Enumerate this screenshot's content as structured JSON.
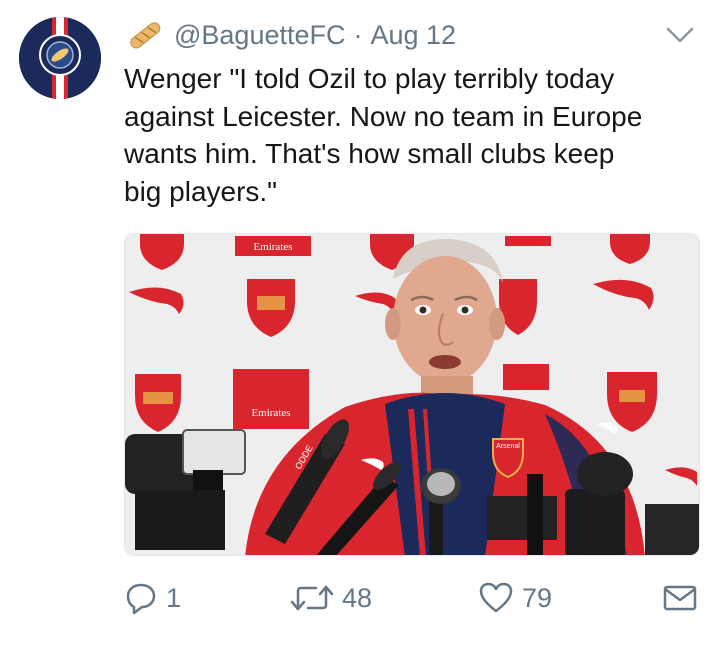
{
  "tweet": {
    "handle": "@BaguetteFC",
    "separator": "·",
    "date": "Aug 12",
    "text_lines": [
      "Wenger \"I told Ozil to play terribly today",
      "against Leicester. Now no team in Europe",
      "wants him. That's how small clubs keep",
      "big players.\""
    ],
    "media": {
      "board_text": [
        "Emirates",
        "Emirates",
        "Emirates"
      ],
      "shirt_text": "Arsenal",
      "mic_text": "ODDE"
    }
  },
  "actions": {
    "reply_count": "1",
    "retweet_count": "48",
    "like_count": "79"
  },
  "icons": {
    "header_emoji": "baguette-icon",
    "menu": "chevron-down-icon",
    "reply": "reply-icon",
    "retweet": "retweet-icon",
    "like": "heart-icon",
    "dm": "envelope-icon"
  },
  "colors": {
    "text": "#14171a",
    "secondary": "#657786",
    "avatar_blue": "#1b2a5a",
    "avatar_red": "#d9262e",
    "shirt_red": "#d9262e"
  }
}
